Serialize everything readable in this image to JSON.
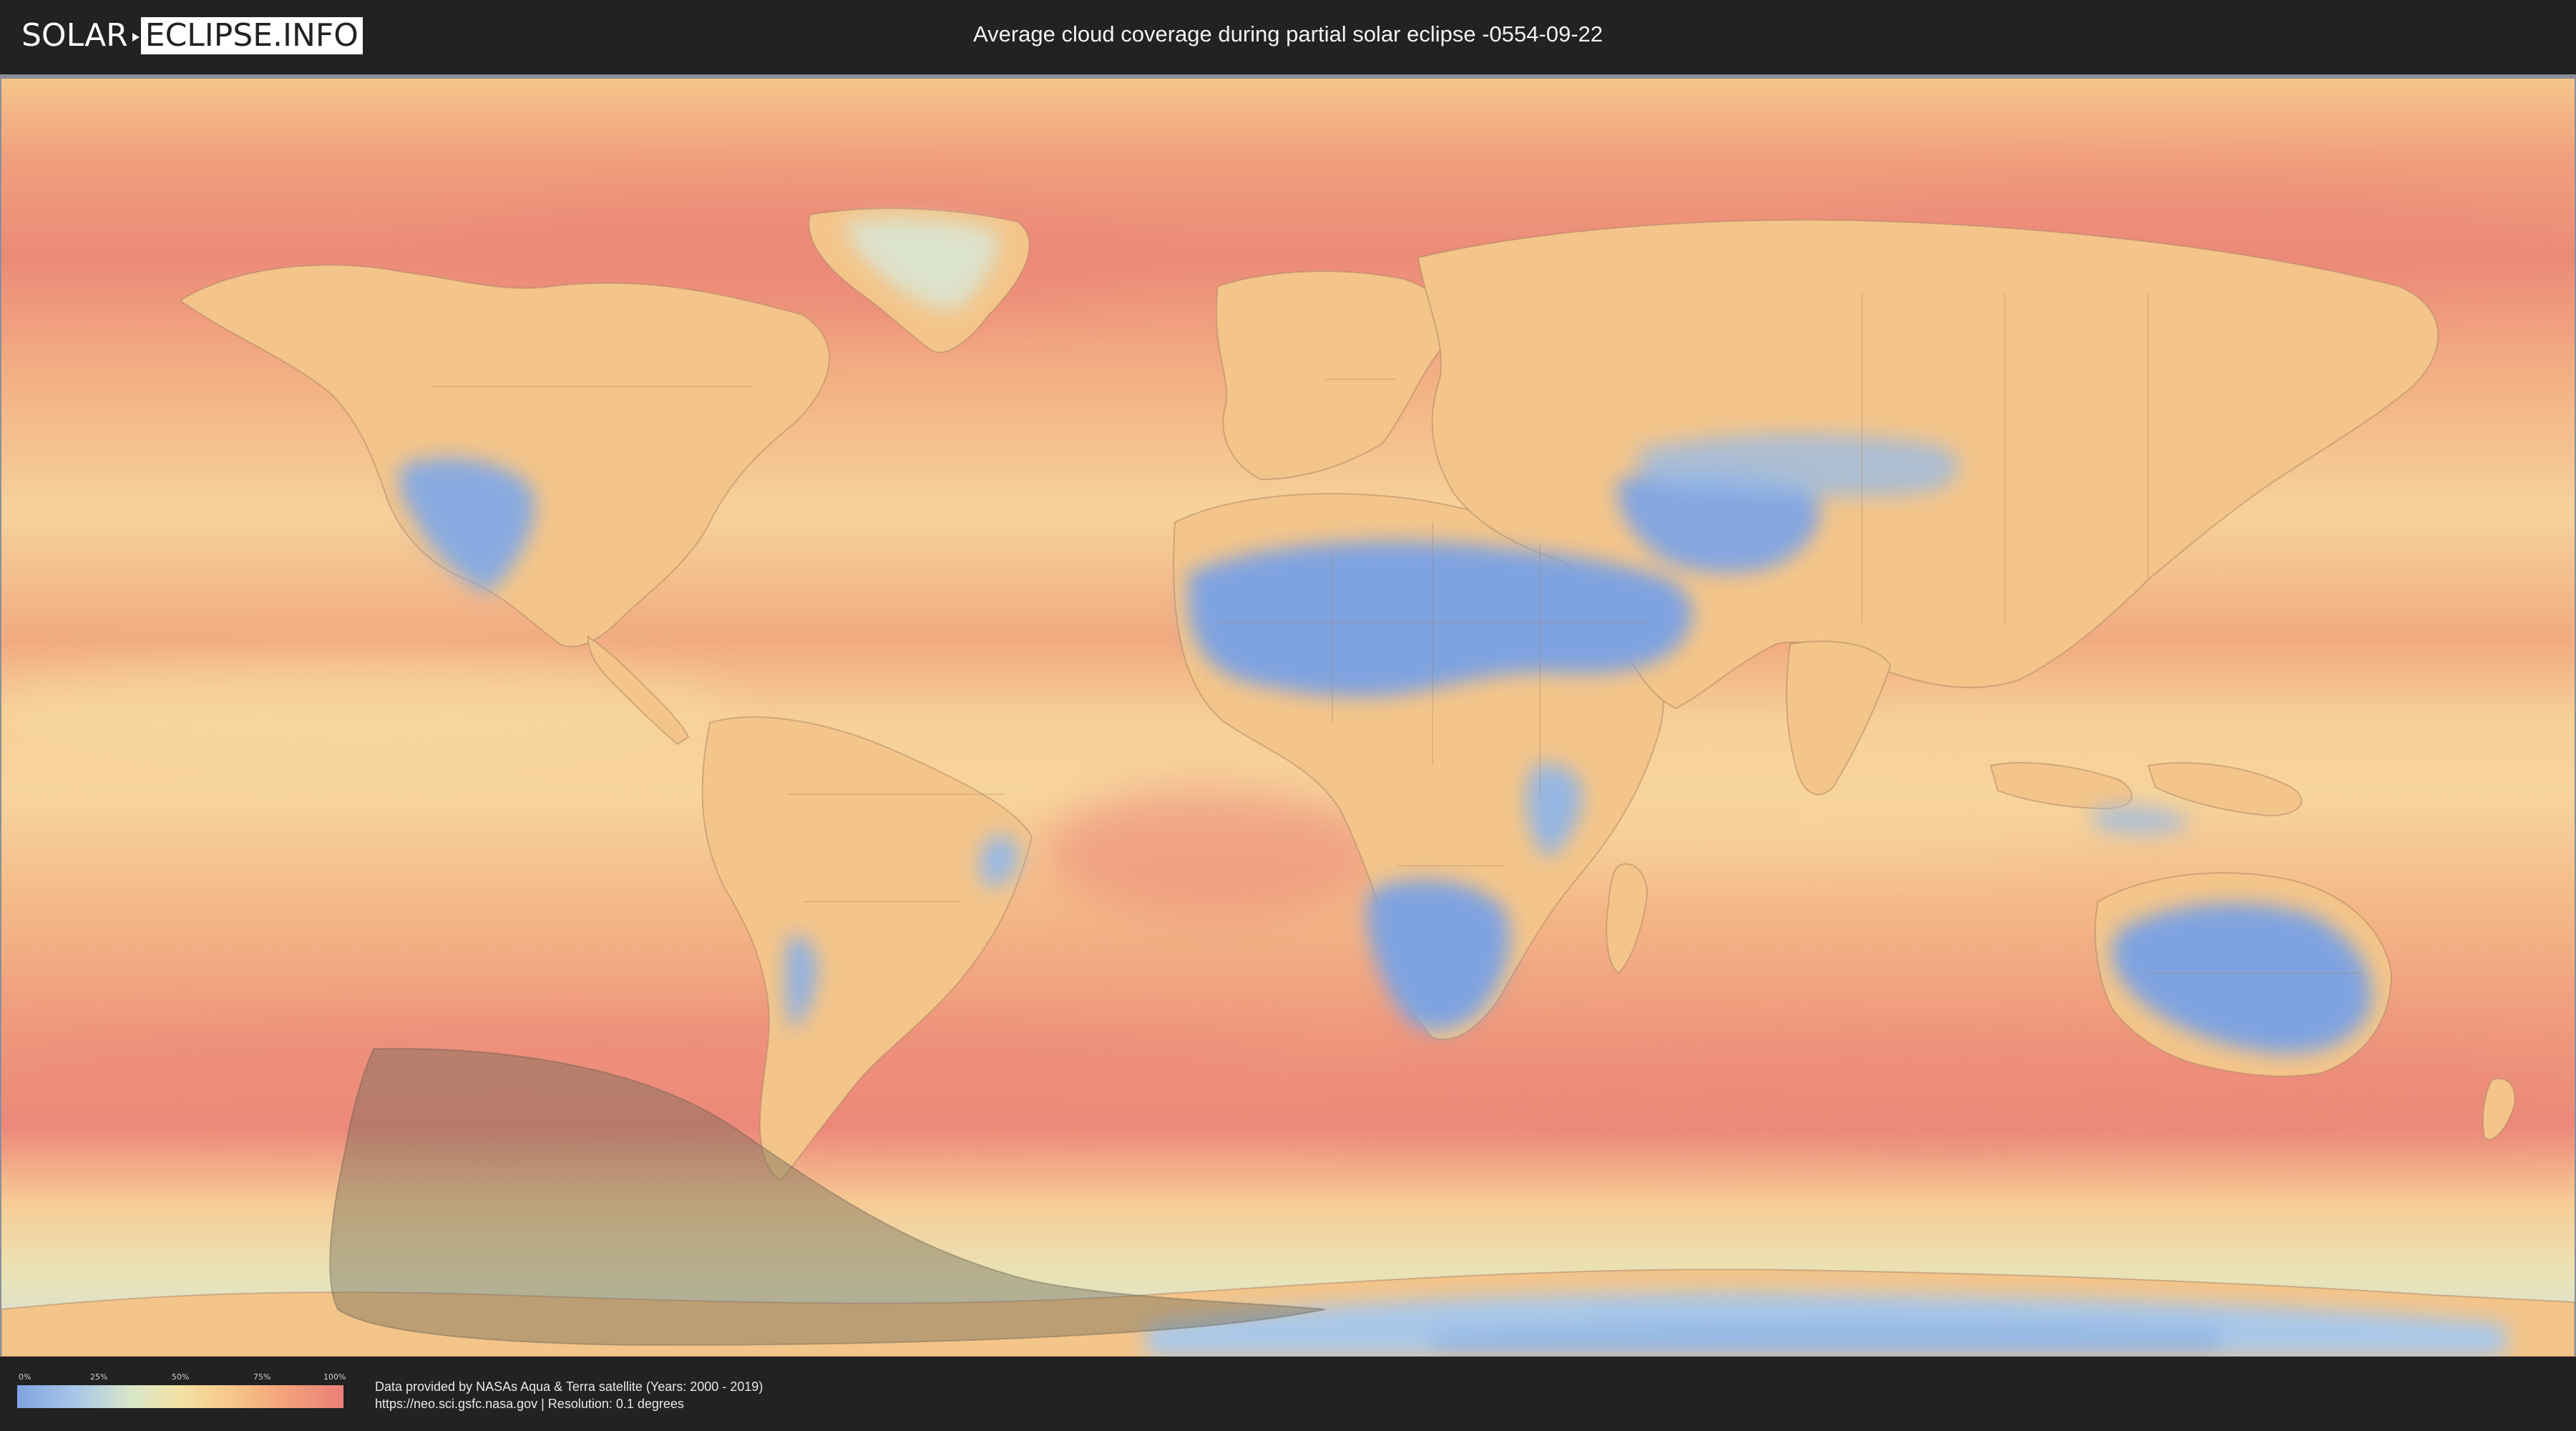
{
  "header": {
    "logo_part1": "SOLAR",
    "logo_part2": "ECLIPSE.INFO",
    "title": "Average cloud coverage during partial solar eclipse -0554-09-22"
  },
  "map": {
    "layer": "average cloud coverage",
    "projection": "equirectangular",
    "overlay": "partial eclipse visibility zone (dark shaded area, southern Pacific / Antarctica)",
    "colors": {
      "clear": "#7fa3e0",
      "low": "#a8c7e8",
      "mid": "#f3e2a4",
      "high": "#f3a27a",
      "overcast": "#ea7f7a",
      "eclipse_zone": "#6e6a58"
    }
  },
  "legend": {
    "ticks": [
      "0%",
      "25%",
      "50%",
      "75%",
      "100%"
    ],
    "scale": [
      0,
      25,
      50,
      75,
      100
    ]
  },
  "footer": {
    "credit_line1": "Data provided by NASAs Aqua & Terra satellite (Years: 2000 - 2019)",
    "credit_line2": "https://neo.sci.gsfc.nasa.gov | Resolution: 0.1 degrees"
  }
}
